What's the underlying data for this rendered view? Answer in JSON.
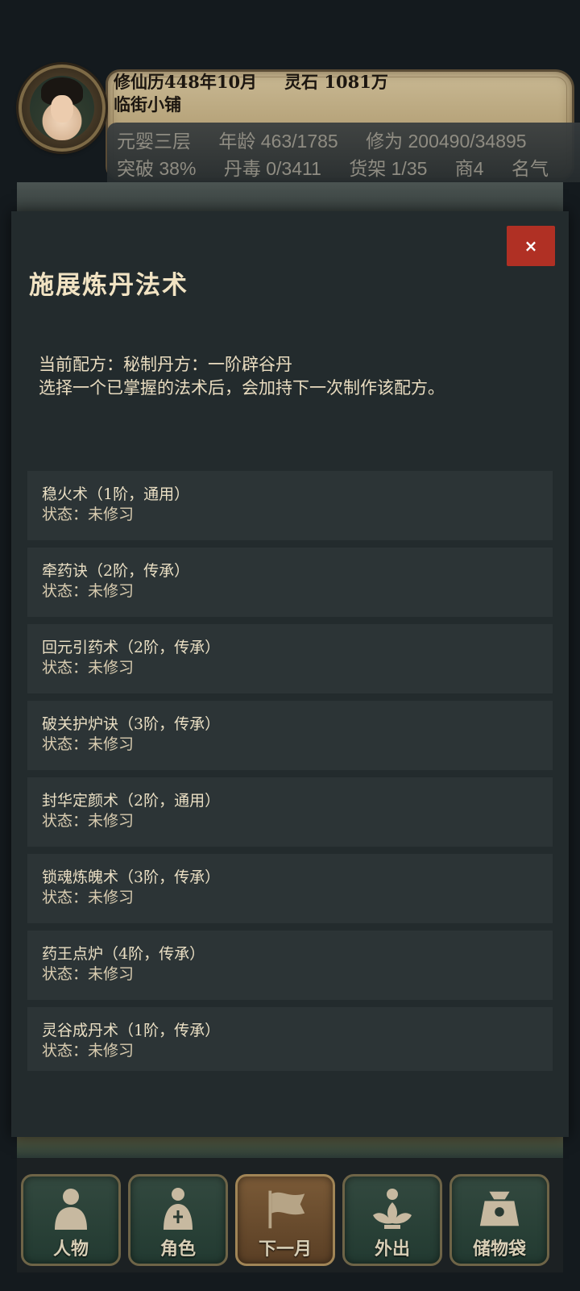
{
  "header": {
    "calendar": "修仙历448年10月",
    "spirit_stones": "灵石 1081万",
    "shop_name": "临街小铺",
    "stats_row1": [
      "元婴三层",
      "年龄 463/1785",
      "修为 200490/34895"
    ],
    "stats_row2": [
      "突破 38%",
      "丹毒 0/3411",
      "货架 1/35",
      "商4",
      "名气"
    ]
  },
  "modal": {
    "title": "施展炼丹法术",
    "close_label": "×",
    "description_line1": "当前配方：秘制丹方：一阶辟谷丹",
    "description_line2": "选择一个已掌握的法术后，会加持下一次制作该配方。",
    "spells": [
      {
        "name": "稳火术（1阶，通用）",
        "status": "状态：未修习"
      },
      {
        "name": "牵药诀（2阶，传承）",
        "status": "状态：未修习"
      },
      {
        "name": "回元引药术（2阶，传承）",
        "status": "状态：未修习"
      },
      {
        "name": "破关护炉诀（3阶，传承）",
        "status": "状态：未修习"
      },
      {
        "name": "封华定颜术（2阶，通用）",
        "status": "状态：未修习"
      },
      {
        "name": "锁魂炼魄术（3阶，传承）",
        "status": "状态：未修习"
      },
      {
        "name": "药王点炉（4阶，传承）",
        "status": "状态：未修习"
      },
      {
        "name": "灵谷成丹术（1阶，传承）",
        "status": "状态：未修习"
      }
    ]
  },
  "nav": {
    "character": "人物",
    "role": "角色",
    "next_month": "下一月",
    "go_out": "外出",
    "storage_bag": "储物袋"
  },
  "colors": {
    "close_button": "#b03024",
    "modal_bg": "#232b2d",
    "spell_row_bg": "#2c3436",
    "header_parchment": "#bfae86"
  }
}
